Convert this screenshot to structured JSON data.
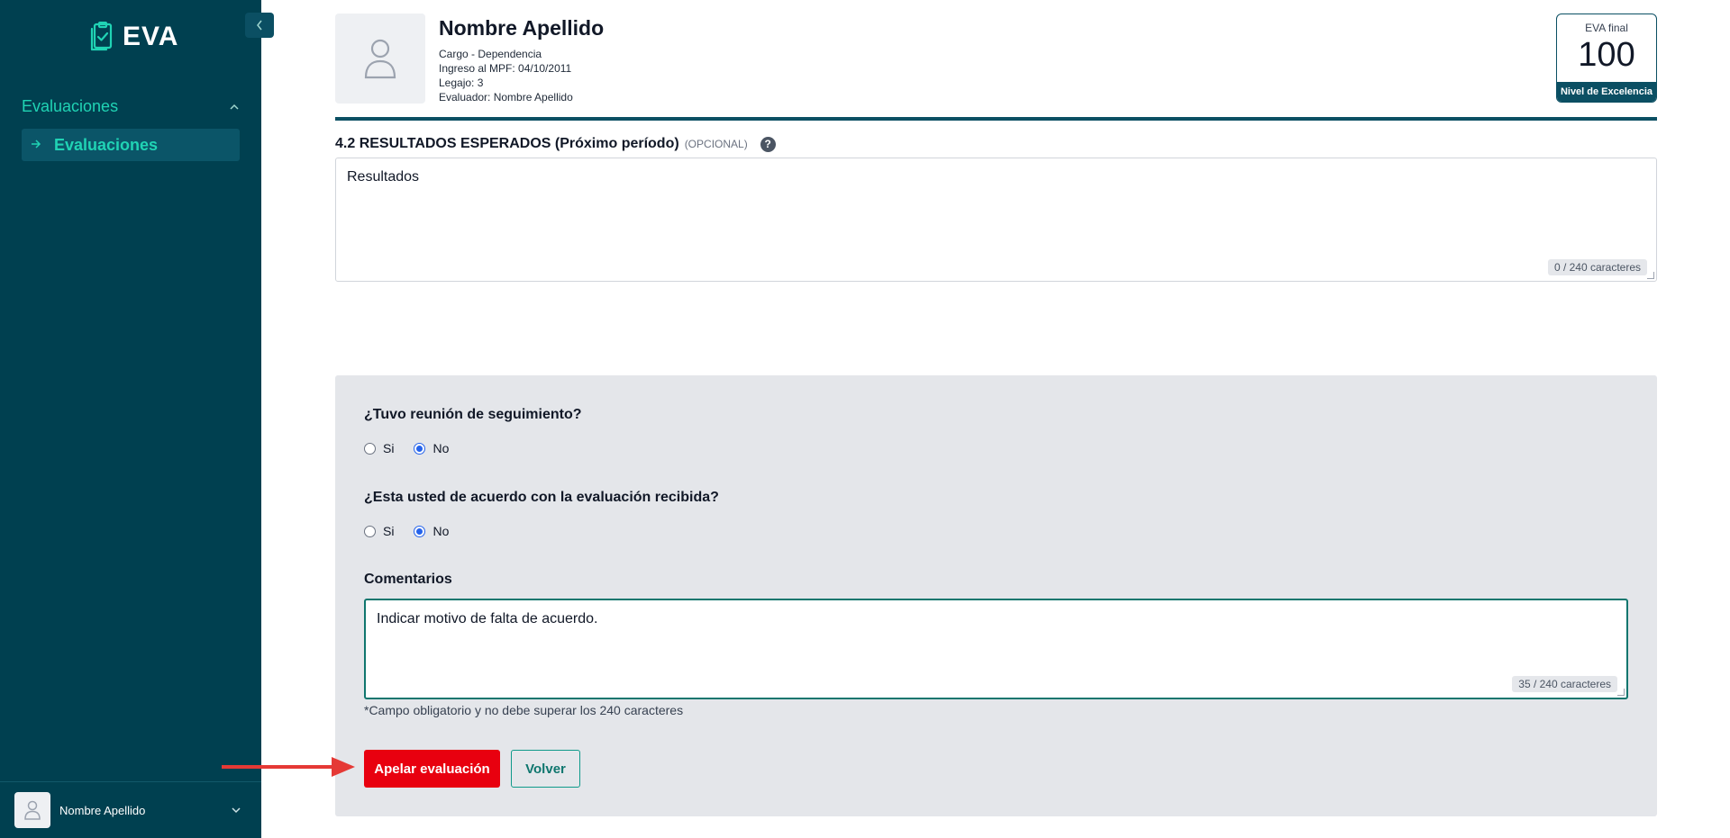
{
  "app": {
    "logo_text": "EVA",
    "collapse_icon": "chevron-left-icon"
  },
  "sidebar": {
    "group_label": "Evaluaciones",
    "items": [
      {
        "label": "Evaluaciones",
        "active": true
      }
    ],
    "user": {
      "name": "Nombre Apellido"
    }
  },
  "header": {
    "name": "Nombre Apellido",
    "cargo": "Cargo - Dependencia",
    "ingreso": "Ingreso al MPF: 04/10/2011",
    "legajo": "Legajo: 3",
    "evaluador": "Evaluador: Nombre Apellido",
    "score": {
      "label": "EVA final",
      "value": "100",
      "level": "Nivel de Excelencia"
    }
  },
  "section_42": {
    "title": "4.2 RESULTADOS ESPERADOS (Próximo período)",
    "optional": "(OPCIONAL)",
    "help": "?",
    "value": "Resultados",
    "counter": "0 / 240 caracteres"
  },
  "followup": {
    "question": "¿Tuvo reunión de seguimiento?",
    "options": [
      "Si",
      "No"
    ],
    "selected": "No"
  },
  "agreement": {
    "question": "¿Esta usted de acuerdo con la evaluación recibida?",
    "options": [
      "Si",
      "No"
    ],
    "selected": "No"
  },
  "comments": {
    "label": "Comentarios",
    "value": "Indicar motivo de falta de acuerdo.",
    "counter": "35 / 240 caracteres",
    "hint": "*Campo obligatorio y no debe superar los 240 caracteres"
  },
  "actions": {
    "appeal_label": "Apelar evaluación",
    "back_label": "Volver"
  },
  "colors": {
    "sidebar_bg": "#004050",
    "accent": "#20d3b4",
    "appeal_red": "#e8000f",
    "annotation_arrow": "#e53935"
  }
}
